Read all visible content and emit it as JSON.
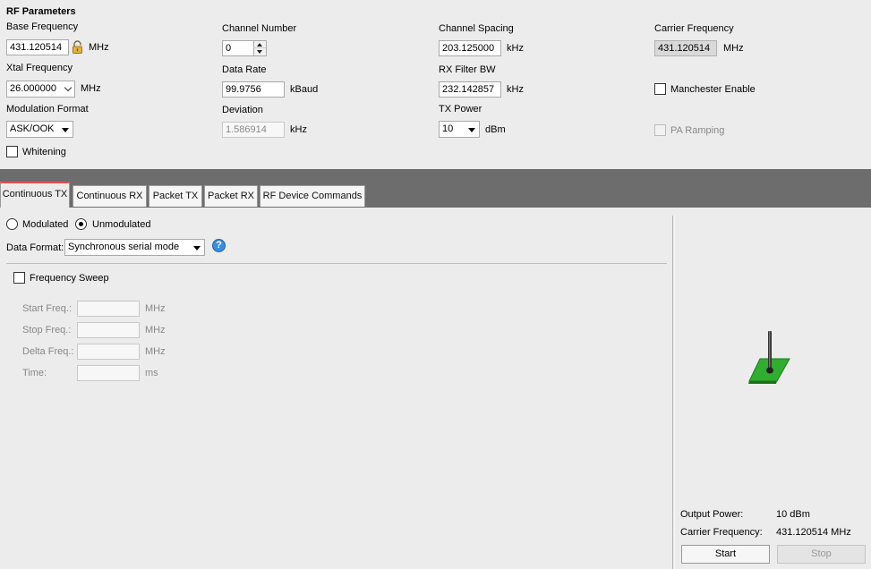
{
  "rf": {
    "section_title": "RF Parameters",
    "base_frequency": {
      "label": "Base Frequency",
      "value": "431.120514",
      "unit": "MHz"
    },
    "channel_number": {
      "label": "Channel Number",
      "value": "0"
    },
    "channel_spacing": {
      "label": "Channel Spacing",
      "value": "203.125000",
      "unit": "kHz"
    },
    "carrier_frequency": {
      "label": "Carrier Frequency",
      "value": "431.120514",
      "unit": "MHz"
    },
    "xtal_frequency": {
      "label": "Xtal Frequency",
      "value": "26.000000",
      "unit": "MHz"
    },
    "data_rate": {
      "label": "Data Rate",
      "value": "99.9756",
      "unit": "kBaud"
    },
    "rx_filter_bw": {
      "label": "RX Filter BW",
      "value": "232.142857",
      "unit": "kHz"
    },
    "manchester": {
      "label": "Manchester Enable",
      "checked": false
    },
    "modulation_format": {
      "label": "Modulation Format",
      "value": "ASK/OOK"
    },
    "deviation": {
      "label": "Deviation",
      "value": "1.586914",
      "unit": "kHz"
    },
    "tx_power": {
      "label": "TX Power",
      "value": "10",
      "unit": "dBm"
    },
    "pa_ramping": {
      "label": "PA Ramping",
      "checked": false
    },
    "whitening": {
      "label": "Whitening",
      "checked": false
    }
  },
  "tabs": [
    {
      "label": "Continuous TX",
      "active": true
    },
    {
      "label": "Continuous RX",
      "active": false
    },
    {
      "label": "Packet TX",
      "active": false
    },
    {
      "label": "Packet RX",
      "active": false
    },
    {
      "label": "RF Device Commands",
      "active": false
    }
  ],
  "ctx": {
    "modulated_label": "Modulated",
    "unmodulated_label": "Unmodulated",
    "selected_mode": "Unmodulated",
    "data_format_label": "Data Format:",
    "data_format_value": "Synchronous serial mode",
    "help_glyph": "?",
    "sweep_label": "Frequency Sweep",
    "sweep": [
      {
        "label": "Start Freq.:",
        "value": "",
        "unit": "MHz"
      },
      {
        "label": "Stop Freq.:",
        "value": "",
        "unit": "MHz"
      },
      {
        "label": "Delta Freq.:",
        "value": "",
        "unit": "MHz"
      },
      {
        "label": "Time:",
        "value": "",
        "unit": "ms"
      }
    ]
  },
  "status": {
    "output_power_label": "Output Power:",
    "output_power_value": "10 dBm",
    "carrier_label": "Carrier Frequency:",
    "carrier_value": "431.120514 MHz",
    "start_label": "Start",
    "stop_label": "Stop"
  },
  "colors": {
    "accent_tab": "#e05050",
    "antenna_green": "#2fae2f",
    "tabbar": "#6d6d6d"
  },
  "icons": {
    "lock": "lock-icon",
    "antenna": "antenna-icon",
    "help": "help-icon"
  }
}
